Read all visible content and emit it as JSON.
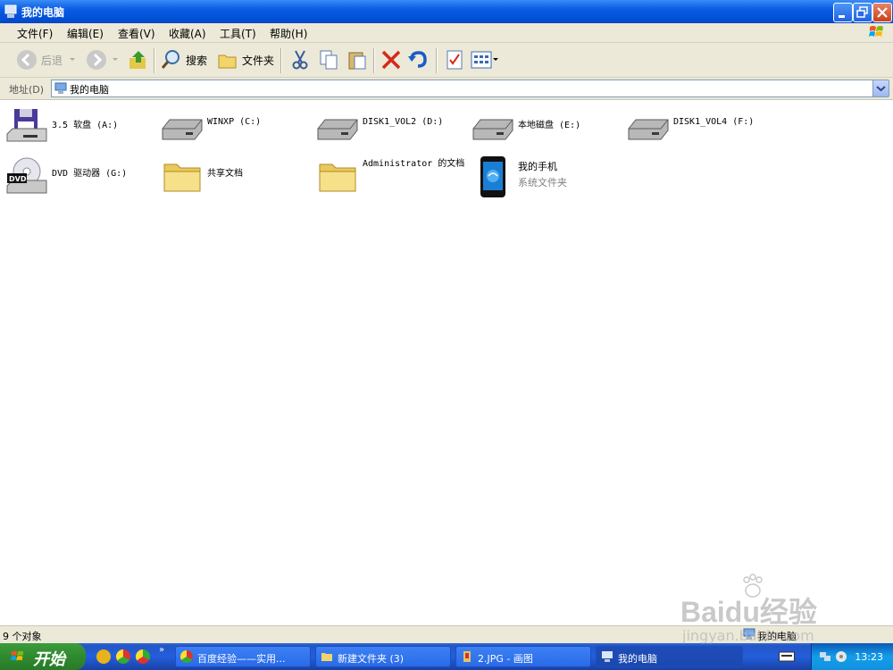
{
  "window": {
    "title": "我的电脑"
  },
  "menu": [
    "文件(F)",
    "编辑(E)",
    "查看(V)",
    "收藏(A)",
    "工具(T)",
    "帮助(H)"
  ],
  "toolbar": {
    "back": "后退",
    "search": "搜索",
    "folders": "文件夹"
  },
  "address": {
    "label": "地址(D)",
    "value": "我的电脑"
  },
  "items": [
    {
      "name": "3.5 软盘 (A:)",
      "icon": "floppy-drive-icon"
    },
    {
      "name": "WINXP (C:)",
      "icon": "hard-disk-icon"
    },
    {
      "name": "DISK1_VOL2 (D:)",
      "icon": "hard-disk-icon"
    },
    {
      "name": "本地磁盘 (E:)",
      "icon": "hard-disk-icon"
    },
    {
      "name": "DISK1_VOL4 (F:)",
      "icon": "hard-disk-icon"
    },
    {
      "name": "DVD 驱动器 (G:)",
      "icon": "dvd-drive-icon"
    },
    {
      "name": "共享文档",
      "icon": "folder-icon"
    },
    {
      "name": "Administrator 的文档",
      "icon": "folder-icon"
    },
    {
      "name": "我的手机",
      "sub": "系统文件夹",
      "icon": "phone-icon"
    }
  ],
  "status": {
    "count": "9 个对象",
    "location": "我的电脑"
  },
  "taskbar": {
    "start": "开始",
    "tasks": [
      "百度经验——实用...",
      "新建文件夹 (3)",
      "2.JPG - 画图",
      "我的电脑"
    ],
    "clock": "13:23"
  },
  "watermark": {
    "brand": "Baidu经验",
    "url": "jingyan.baidu.com"
  }
}
